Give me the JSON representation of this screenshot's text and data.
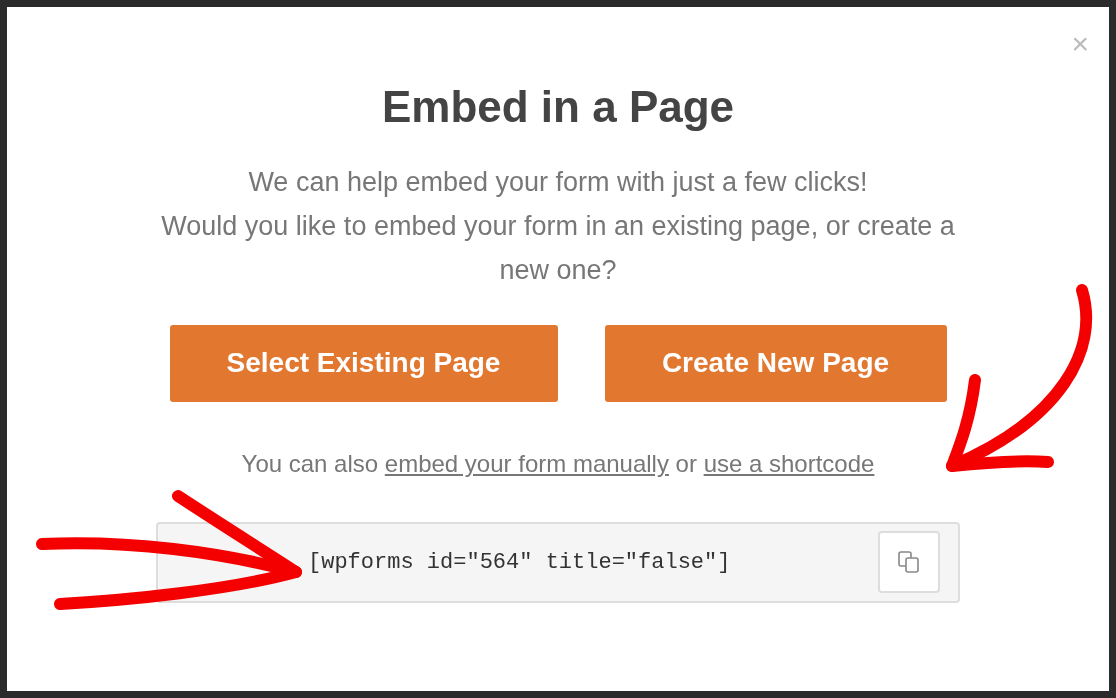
{
  "close": "×",
  "title": "Embed in a Page",
  "intro": [
    "We can help embed your form with just a few clicks!",
    "Would you like to embed your form in an existing page, or create a new one?"
  ],
  "buttons": [
    "Select Existing Page",
    "Create New Page"
  ],
  "alternative": {
    "prefix": "You can also",
    "link_1": "embed your form manually",
    "middle": "or",
    "link_2": "use a shortcode"
  },
  "shortcode": {
    "value": "[wpforms id=\"564\" title=\"false\"]"
  }
}
